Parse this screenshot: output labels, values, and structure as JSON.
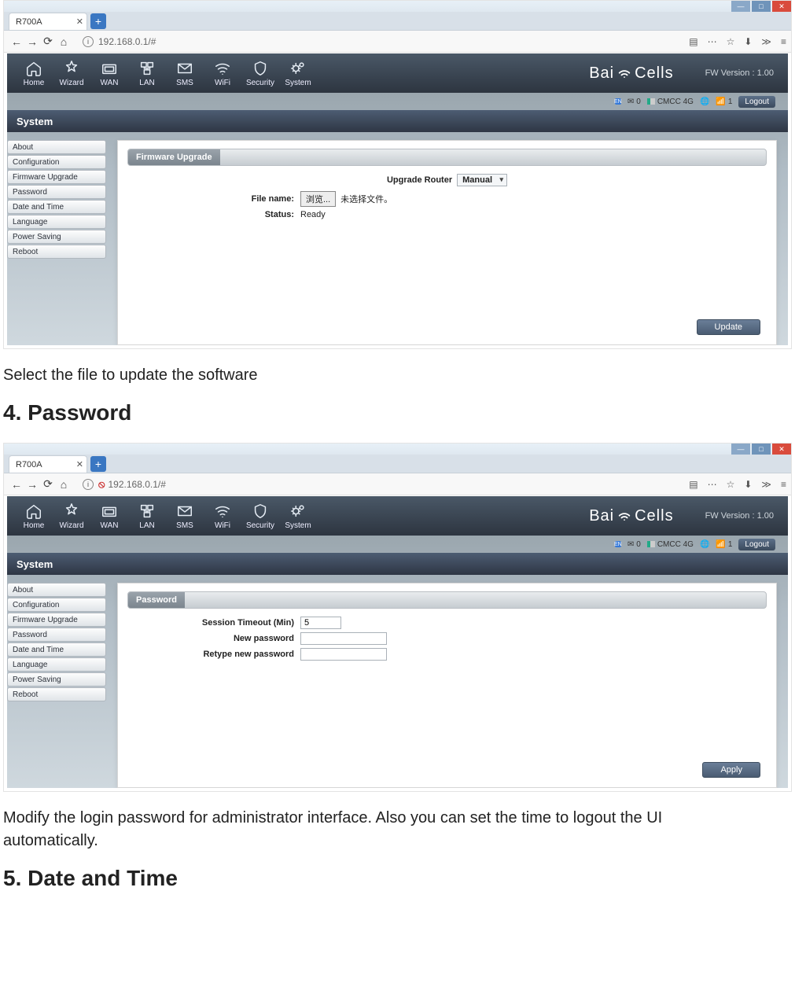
{
  "doc": {
    "text1": "Select the file to update the software",
    "heading4": "4. Password",
    "text2": "Modify the login password for administrator interface. Also you can set the time to logout the UI",
    "text3": "automatically.",
    "heading5": "5. Date and Time"
  },
  "screenshotA": {
    "browser": {
      "tab_title": "R700A",
      "url": "192.168.0.1/#",
      "blocked": false
    },
    "router": {
      "brand": "BaiCells",
      "brand_left": "Bai",
      "brand_right": "Cells",
      "fw_label": "FW Version : 1.00",
      "nav": [
        "Home",
        "Wizard",
        "WAN",
        "LAN",
        "SMS",
        "WiFi",
        "Security",
        "System"
      ],
      "status": {
        "lang": "EN",
        "msg_count": "0",
        "carrier": "CMCC  4G",
        "conn_count": "1",
        "logout": "Logout"
      },
      "section": "System",
      "sidebar": [
        "About",
        "Configuration",
        "Firmware Upgrade",
        "Password",
        "Date and Time",
        "Language",
        "Power Saving",
        "Reboot"
      ],
      "panel_title": "Firmware Upgrade",
      "upgrade_router_label": "Upgrade Router",
      "upgrade_router_value": "Manual",
      "file_name_label": "File name:",
      "file_browse_label": "浏览...",
      "file_none_label": "未选择文件。",
      "status_label": "Status:",
      "status_value": "Ready",
      "action": "Update"
    }
  },
  "screenshotB": {
    "browser": {
      "tab_title": "R700A",
      "url": "192.168.0.1/#",
      "blocked": true
    },
    "router": {
      "brand": "BaiCells",
      "brand_left": "Bai",
      "brand_right": "Cells",
      "fw_label": "FW Version : 1.00",
      "nav": [
        "Home",
        "Wizard",
        "WAN",
        "LAN",
        "SMS",
        "WiFi",
        "Security",
        "System"
      ],
      "status": {
        "lang": "EN",
        "msg_count": "0",
        "carrier": "CMCC  4G",
        "conn_count": "1",
        "logout": "Logout"
      },
      "section": "System",
      "sidebar": [
        "About",
        "Configuration",
        "Firmware Upgrade",
        "Password",
        "Date and Time",
        "Language",
        "Power Saving",
        "Reboot"
      ],
      "panel_title": "Password",
      "session_label": "Session Timeout (Min)",
      "session_value": "5",
      "newpw_label": "New password",
      "retype_label": "Retype new password",
      "action": "Apply"
    }
  }
}
